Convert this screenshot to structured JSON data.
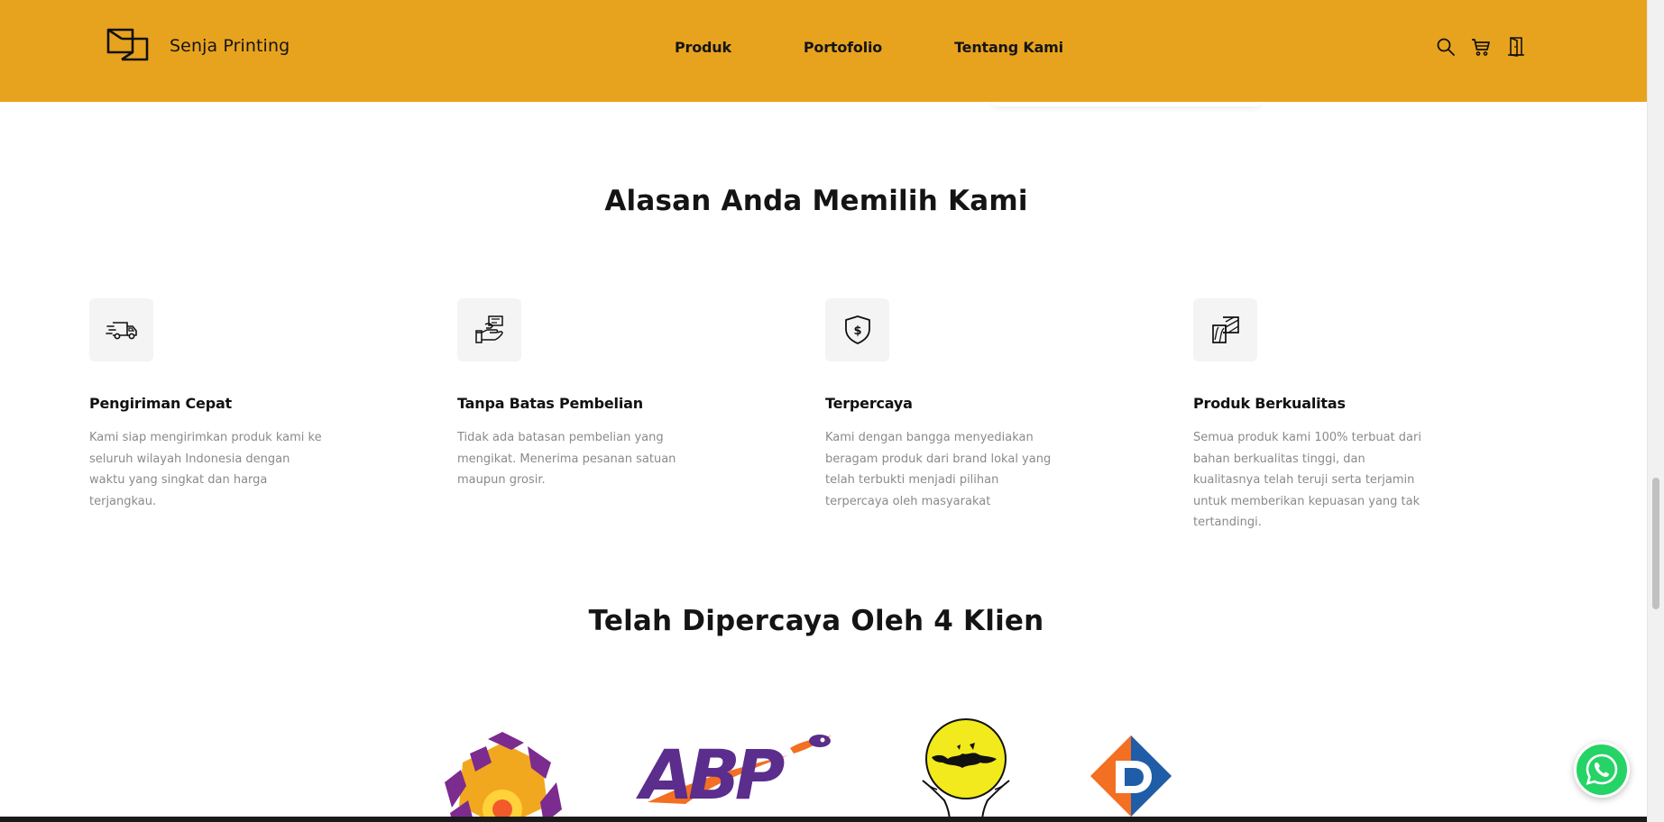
{
  "header": {
    "brand": "Senja Printing",
    "nav": [
      "Produk",
      "Portofolio",
      "Tentang Kami"
    ],
    "icons": [
      "search-icon",
      "cart-icon",
      "door-exit-icon"
    ],
    "bg_color": "#e8a31e"
  },
  "why": {
    "title": "Alasan Anda Memilih Kami",
    "features": [
      {
        "icon": "delivery-truck-icon",
        "title": "Pengiriman Cepat",
        "desc": "Kami siap mengirimkan produk kami ke seluruh wilayah Indonesia dengan waktu yang singkat dan harga terjangkau."
      },
      {
        "icon": "hand-money-icon",
        "title": "Tanpa Batas Pembelian",
        "desc": "Tidak ada batasan pembelian yang mengikat. Menerima pesanan satuan maupun grosir."
      },
      {
        "icon": "shield-dollar-icon",
        "title": "Terpercaya",
        "desc": "Kami dengan bangga menyediakan beragam produk dari brand lokal yang telah terbukti menjadi pilihan terpercaya oleh masyarakat"
      },
      {
        "icon": "quality-materials-icon",
        "title": "Produk Berkualitas",
        "desc": "Semua produk kami 100% terbuat dari bahan berkualitas tinggi, dan kualitasnya telah teruji serta terjamin untuk memberikan kepuasan yang tak tertandingi."
      }
    ]
  },
  "clients": {
    "title": "Telah Dipercaya Oleh 4 Klien",
    "logos": [
      "purple-hexagon-logo",
      "abp-logo",
      "indonesia-map-hands-logo",
      "d-diamond-logo"
    ],
    "abp_text": "ABP"
  },
  "whatsapp": {
    "icon": "whatsapp-icon"
  }
}
